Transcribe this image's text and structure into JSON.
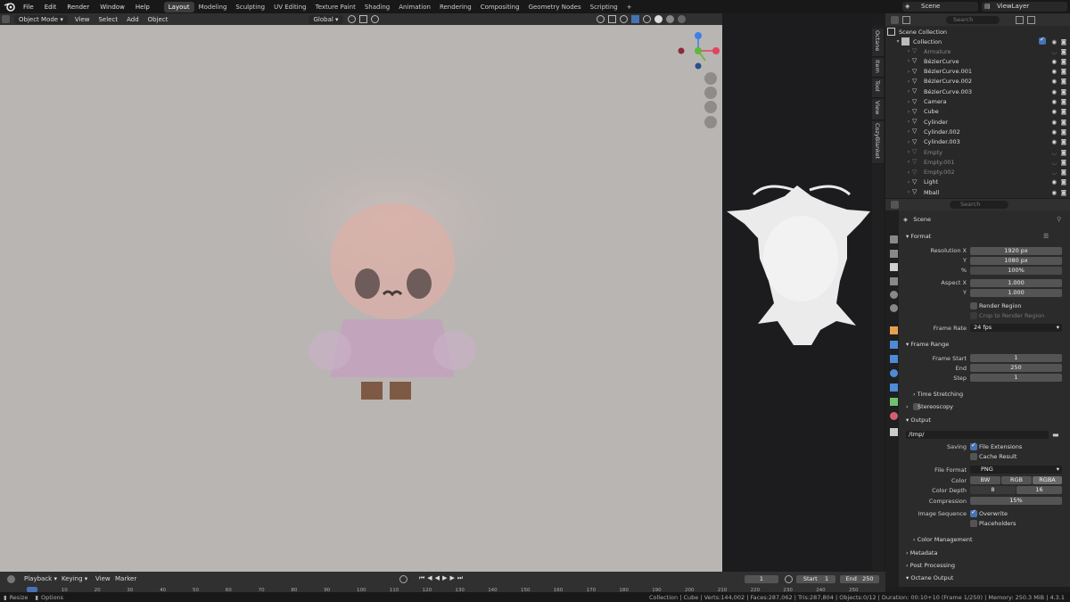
{
  "menubar": {
    "menus": [
      "File",
      "Edit",
      "Render",
      "Window",
      "Help"
    ],
    "workspaces": [
      "Layout",
      "Modeling",
      "Sculpting",
      "UV Editing",
      "Texture Paint",
      "Shading",
      "Animation",
      "Rendering",
      "Compositing",
      "Geometry Nodes",
      "Scripting"
    ],
    "active_workspace": "Layout",
    "add_tab": "+",
    "scene": "Scene",
    "view_layer": "ViewLayer"
  },
  "viewport_header": {
    "mode": "Object Mode",
    "menus": [
      "View",
      "Select",
      "Add",
      "Object"
    ],
    "transform": "Global"
  },
  "gizmo": {
    "x": "X",
    "y": "Y",
    "z": "Z"
  },
  "ntabs": [
    "Octane",
    "Item",
    "Tool",
    "View",
    "CozyBlanket"
  ],
  "outliner": {
    "search_placeholder": "Search",
    "scene_collection": "Scene Collection",
    "collection": "Collection",
    "items": [
      {
        "name": "Armature",
        "dim": true
      },
      {
        "name": "BézierCurve",
        "dim": false
      },
      {
        "name": "BézierCurve.001",
        "dim": false
      },
      {
        "name": "BézierCurve.002",
        "dim": false
      },
      {
        "name": "BézierCurve.003",
        "dim": false
      },
      {
        "name": "Camera",
        "dim": false
      },
      {
        "name": "Cube",
        "dim": false
      },
      {
        "name": "Cylinder",
        "dim": false
      },
      {
        "name": "Cylinder.002",
        "dim": false
      },
      {
        "name": "Cylinder.003",
        "dim": false
      },
      {
        "name": "Empty",
        "dim": true
      },
      {
        "name": "Empty.001",
        "dim": true
      },
      {
        "name": "Empty.002",
        "dim": true
      },
      {
        "name": "Light",
        "dim": false
      },
      {
        "name": "Mball",
        "dim": false
      }
    ]
  },
  "properties": {
    "search_placeholder": "Search",
    "breadcrumb": "Scene",
    "format": {
      "title": "Format",
      "res_x_label": "Resolution X",
      "res_x": "1920 px",
      "res_y_label": "Y",
      "res_y": "1080 px",
      "pct_label": "%",
      "pct": "100%",
      "aspect_x_label": "Aspect X",
      "aspect_x": "1.000",
      "aspect_y_label": "Y",
      "aspect_y": "1.000",
      "render_region": "Render Region",
      "crop_region": "Crop to Render Region",
      "frame_rate_label": "Frame Rate",
      "frame_rate": "24 fps"
    },
    "frame_range": {
      "title": "Frame Range",
      "start_label": "Frame Start",
      "start": "1",
      "end_label": "End",
      "end": "250",
      "step_label": "Step",
      "step": "1"
    },
    "time_stretching": "Time Stretching",
    "stereoscopy": "Stereoscopy",
    "output": {
      "title": "Output",
      "path": "/tmp/",
      "saving_label": "Saving",
      "file_extensions": "File Extensions",
      "cache_result": "Cache Result",
      "file_format_label": "File Format",
      "file_format": "PNG",
      "color_label": "Color",
      "color_options": [
        "BW",
        "RGB",
        "RGBA"
      ],
      "color_selected": "RGBA",
      "depth_label": "Color Depth",
      "depth_options": [
        "8",
        "16"
      ],
      "compression_label": "Compression",
      "compression": "15%",
      "image_seq_label": "Image Sequence",
      "overwrite": "Overwrite",
      "placeholders": "Placeholders"
    },
    "color_management": "Color Management",
    "metadata": "Metadata",
    "post_processing": "Post Processing",
    "octane_output": "Octane Output"
  },
  "timeline": {
    "menus": [
      "Playback",
      "Keying",
      "View",
      "Marker"
    ],
    "current_frame": "1",
    "start_label": "Start",
    "start": "1",
    "end_label": "End",
    "end": "250",
    "ticks": [
      "0",
      "10",
      "20",
      "30",
      "40",
      "50",
      "60",
      "70",
      "80",
      "90",
      "100",
      "110",
      "120",
      "130",
      "140",
      "150",
      "160",
      "170",
      "180",
      "190",
      "200",
      "210",
      "220",
      "230",
      "240",
      "250"
    ]
  },
  "statusbar": {
    "left1": "Resize",
    "left2": "Options",
    "info": "Collection | Cube | Verts:144,002 | Faces:287,062 | Tris:287,804 | Objects:0/12 | Duration: 00:10+10 (Frame 1/250) | Memory: 250.3 MiB | 4.3.1"
  },
  "colors": {
    "accent": "#4772b3",
    "viewport_bg": "#b9b5b3",
    "gizmo_x": "#e2435f",
    "gizmo_y": "#5fb83a",
    "gizmo_z": "#3f7ee8"
  }
}
